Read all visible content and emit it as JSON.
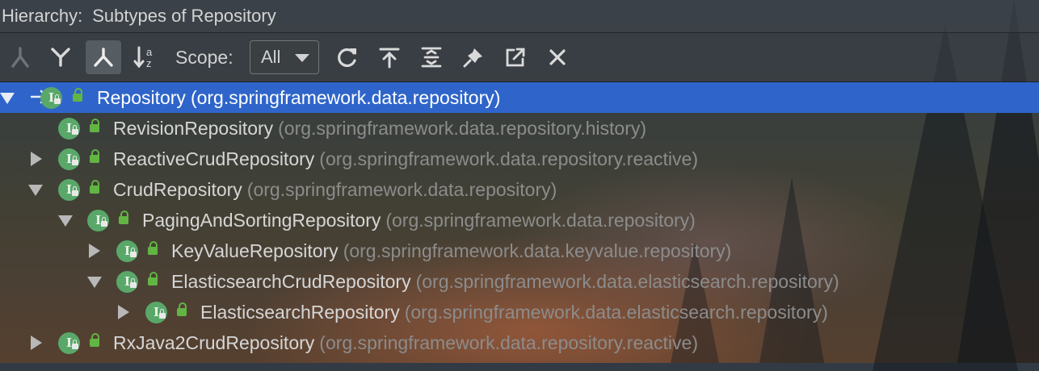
{
  "titlebar": {
    "label": "Hierarchy:",
    "subtitle": "Subtypes of Repository"
  },
  "toolbar": {
    "buttons": [
      {
        "icon": "class-hierarchy-icon",
        "enabled": false
      },
      {
        "icon": "supertypes-hierarchy-icon"
      },
      {
        "icon": "subtypes-hierarchy-icon",
        "active": true
      },
      {
        "icon": "sort-alphabetically-icon"
      }
    ],
    "scope_label": "Scope:",
    "scope_value": "All",
    "actions": [
      "refresh-icon",
      "scroll-from-source-icon",
      "expand-all-icon",
      "pin-icon",
      "open-in-new-window-icon",
      "close-icon"
    ]
  },
  "tree": {
    "rows": [
      {
        "name": "Repository",
        "package": "(org.springframework.data.repository)",
        "expanded": true,
        "selected": true,
        "level": 0
      },
      {
        "name": "RevisionRepository",
        "package": "(org.springframework.data.repository.history)",
        "leaf": true,
        "level": 1
      },
      {
        "name": "ReactiveCrudRepository",
        "package": "(org.springframework.data.repository.reactive)",
        "expanded": false,
        "level": 1
      },
      {
        "name": "CrudRepository",
        "package": "(org.springframework.data.repository)",
        "expanded": true,
        "level": 1
      },
      {
        "name": "PagingAndSortingRepository",
        "package": "(org.springframework.data.repository)",
        "expanded": true,
        "level": 2
      },
      {
        "name": "KeyValueRepository",
        "package": "(org.springframework.data.keyvalue.repository)",
        "expanded": false,
        "level": 3
      },
      {
        "name": "ElasticsearchCrudRepository",
        "package": "(org.springframework.data.elasticsearch.repository)",
        "expanded": true,
        "level": 3
      },
      {
        "name": "ElasticsearchRepository",
        "package": "(org.springframework.data.elasticsearch.repository)",
        "expanded": false,
        "level": 4
      },
      {
        "name": "RxJava2CrudRepository",
        "package": "(org.springframework.data.repository.reactive)",
        "expanded": false,
        "level": 1
      }
    ]
  },
  "colors": {
    "selection": "#2f65ca",
    "interface_icon": "#59a869",
    "lock": "#62b543"
  },
  "icons": {
    "interface": "interface-icon",
    "visibility": "public-lock-icon"
  }
}
